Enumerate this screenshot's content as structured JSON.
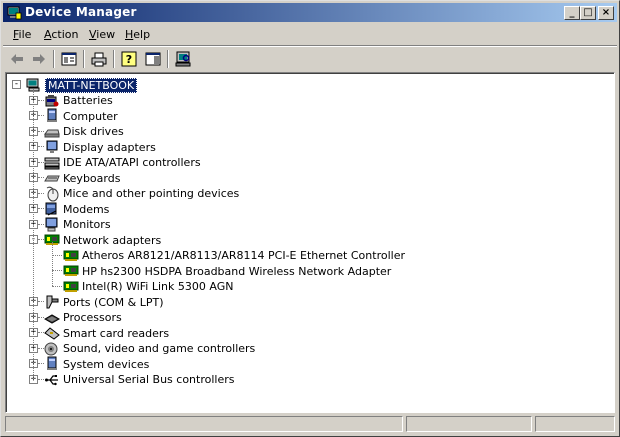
{
  "window": {
    "title": "Device Manager",
    "controls": [
      "_",
      "□",
      "×"
    ]
  },
  "menu": [
    {
      "label": "File",
      "u": "F",
      "rest": "ile"
    },
    {
      "label": "Action",
      "u": "A",
      "rest": "ction"
    },
    {
      "label": "View",
      "u": "V",
      "rest": "iew"
    },
    {
      "label": "Help",
      "u": "H",
      "rest": "elp"
    }
  ],
  "toolbar": [
    "back-icon",
    "forward-icon",
    "properties-view-icon",
    "print-icon",
    "help-icon",
    "action-pane-icon",
    "scan-hardware-icon"
  ],
  "tree": {
    "root": "MATT-NETBOOK",
    "categories": [
      {
        "label": "Batteries",
        "icon": "battery-icon"
      },
      {
        "label": "Computer",
        "icon": "computer-icon"
      },
      {
        "label": "Disk drives",
        "icon": "disk-drive-icon"
      },
      {
        "label": "Display adapters",
        "icon": "display-adapter-icon"
      },
      {
        "label": "IDE ATA/ATAPI controllers",
        "icon": "ide-controller-icon"
      },
      {
        "label": "Keyboards",
        "icon": "keyboard-icon"
      },
      {
        "label": "Mice and other pointing devices",
        "icon": "mouse-icon"
      },
      {
        "label": "Modems",
        "icon": "modem-icon"
      },
      {
        "label": "Monitors",
        "icon": "monitor-icon"
      },
      {
        "label": "Network adapters",
        "icon": "network-adapter-icon",
        "expanded": true,
        "children": [
          "Atheros AR8121/AR8113/AR8114 PCI-E Ethernet Controller",
          "HP hs2300 HSDPA Broadband Wireless Network Adapter",
          "Intel(R) WiFi Link 5300 AGN"
        ]
      },
      {
        "label": "Ports (COM & LPT)",
        "icon": "port-icon"
      },
      {
        "label": "Processors",
        "icon": "processor-icon"
      },
      {
        "label": "Smart card readers",
        "icon": "smart-card-icon"
      },
      {
        "label": "Sound, video and game controllers",
        "icon": "sound-icon"
      },
      {
        "label": "System devices",
        "icon": "system-device-icon"
      },
      {
        "label": "Universal Serial Bus controllers",
        "icon": "usb-icon"
      }
    ]
  },
  "colors": {
    "title_start": "#0a246a",
    "title_end": "#a6caf0",
    "face": "#d4d0c8",
    "selection": "#0a246a"
  }
}
